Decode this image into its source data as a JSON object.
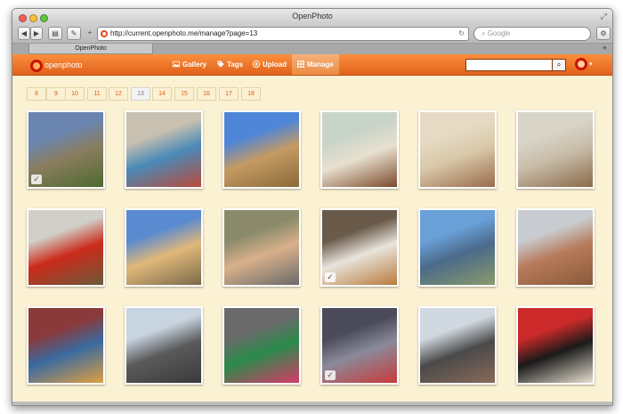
{
  "window": {
    "title": "OpenPhoto"
  },
  "browser": {
    "url": "http://current.openphoto.me/manage?page=13",
    "search_placeholder": "Google",
    "tab_title": "OpenPhoto",
    "tab_add": "+"
  },
  "site": {
    "logo_text": "openphoto",
    "nav": [
      {
        "label": "Gallery",
        "icon": "image-icon"
      },
      {
        "label": "Tags",
        "icon": "tag-icon"
      },
      {
        "label": "Upload",
        "icon": "upload-icon"
      },
      {
        "label": "Manage",
        "icon": "grid-icon",
        "active": true
      }
    ],
    "search_value": "",
    "search_button": "⌕",
    "user_menu_caret": "▾"
  },
  "pagination": {
    "pages": [
      "8",
      "9",
      "10",
      "11",
      "12",
      "13",
      "14",
      "15",
      "16",
      "17",
      "18"
    ],
    "current": "13"
  },
  "photos": [
    {
      "subject": "stone-ruins",
      "selected": true,
      "colors": [
        "#6a86b0",
        "#8a7d5e",
        "#4e6a2e"
      ]
    },
    {
      "subject": "market-stall",
      "selected": false,
      "colors": [
        "#c8c0b0",
        "#4a8ab8",
        "#b84a3a"
      ]
    },
    {
      "subject": "parthenon",
      "selected": false,
      "colors": [
        "#4f86d8",
        "#c49a62",
        "#8a6a3a"
      ]
    },
    {
      "subject": "guard-march",
      "selected": false,
      "colors": [
        "#c8d4c8",
        "#e8e0d0",
        "#7a4a2a"
      ]
    },
    {
      "subject": "guards-pair",
      "selected": false,
      "colors": [
        "#e6dac4",
        "#d8c8a8",
        "#9a6a4a"
      ]
    },
    {
      "subject": "guards-wall",
      "selected": false,
      "colors": [
        "#d8d4c8",
        "#c8bca8",
        "#8a6a4a"
      ]
    },
    {
      "subject": "guard-portrait",
      "selected": false,
      "colors": [
        "#d0d0c8",
        "#cc2a1a",
        "#6a5a3a"
      ]
    },
    {
      "subject": "parliament",
      "selected": false,
      "colors": [
        "#5a8ad0",
        "#e0b87a",
        "#7a6a4a"
      ]
    },
    {
      "subject": "woman-portrait",
      "selected": false,
      "colors": [
        "#8a8a6a",
        "#d8b08a",
        "#6a6a6a"
      ]
    },
    {
      "subject": "coffee-cup",
      "selected": true,
      "colors": [
        "#6a5a4a",
        "#e8e4dc",
        "#b87a3a"
      ]
    },
    {
      "subject": "mountains",
      "selected": false,
      "colors": [
        "#6aa0d8",
        "#4a6a8a",
        "#8a9a6a"
      ]
    },
    {
      "subject": "city-view",
      "selected": false,
      "colors": [
        "#c8ccd0",
        "#b87a5a",
        "#8a5a3a"
      ]
    },
    {
      "subject": "bag-shop",
      "selected": false,
      "colors": [
        "#8a3a3a",
        "#3a6aa0",
        "#e0a040"
      ]
    },
    {
      "subject": "street",
      "selected": false,
      "colors": [
        "#c8d4e0",
        "#5a5a5a",
        "#3a3a3a"
      ]
    },
    {
      "subject": "scarves",
      "selected": false,
      "colors": [
        "#6a6a6a",
        "#2a8a4a",
        "#d83a6a"
      ]
    },
    {
      "subject": "clothes-rack",
      "selected": true,
      "colors": [
        "#4a4a5a",
        "#8a8a9a",
        "#c83a3a"
      ]
    },
    {
      "subject": "crowd",
      "selected": false,
      "colors": [
        "#d0d8e0",
        "#4a4a4a",
        "#8a6a5a"
      ]
    },
    {
      "subject": "caps",
      "selected": false,
      "colors": [
        "#cc2a2a",
        "#1a1a1a",
        "#e8e0d0"
      ]
    }
  ]
}
